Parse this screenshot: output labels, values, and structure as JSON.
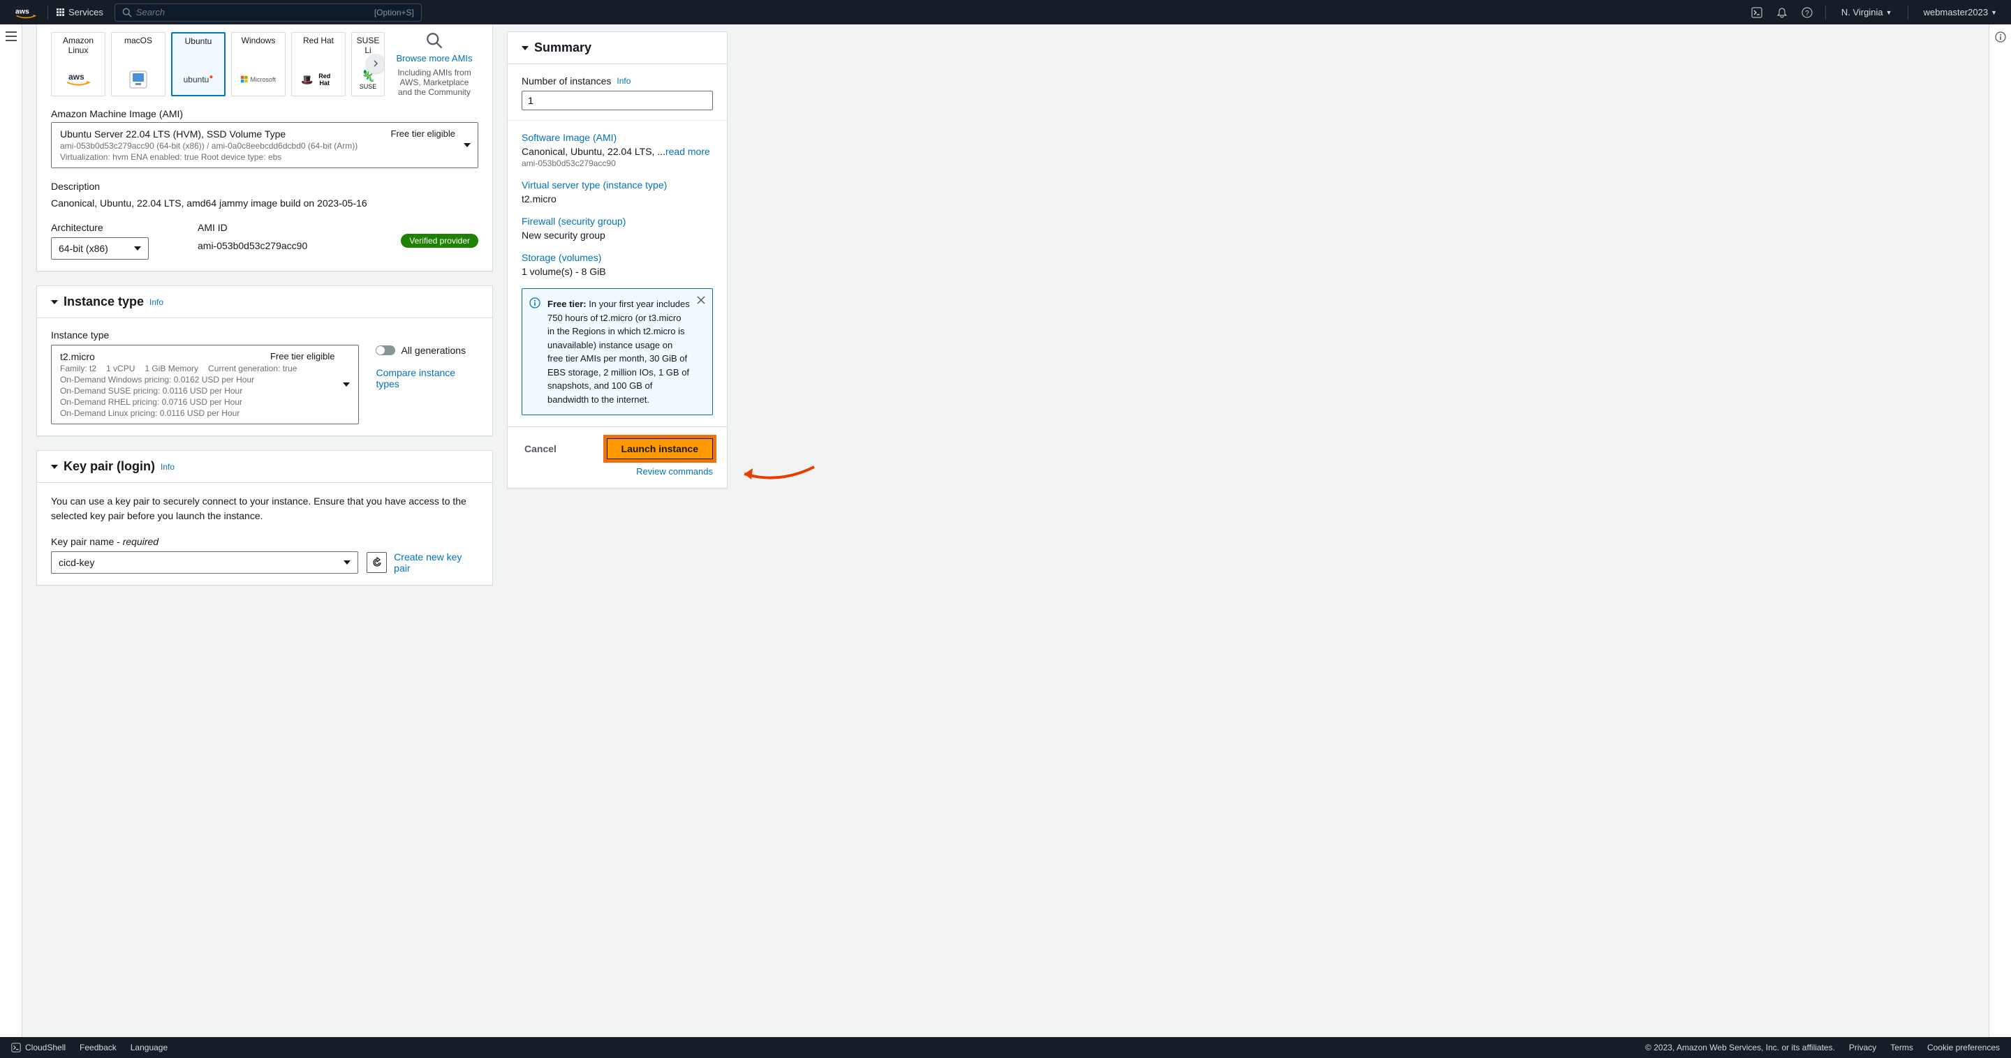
{
  "nav": {
    "services": "Services",
    "search_placeholder": "Search",
    "search_kbd": "[Option+S]",
    "region": "N. Virginia",
    "user": "webmaster2023"
  },
  "os_tiles": [
    {
      "label": "Amazon Linux",
      "logo": "aws"
    },
    {
      "label": "macOS",
      "logo": "mac"
    },
    {
      "label": "Ubuntu",
      "logo": "ubuntu",
      "selected": true
    },
    {
      "label": "Windows",
      "logo": "microsoft"
    },
    {
      "label": "Red Hat",
      "logo": "redhat"
    },
    {
      "label": "SUSE Li",
      "logo": "suse",
      "partial": true
    }
  ],
  "browse": {
    "link": "Browse more AMIs",
    "sub": "Including AMIs from AWS, Marketplace and the Community"
  },
  "ami": {
    "section_label": "Amazon Machine Image (AMI)",
    "title": "Ubuntu Server 22.04 LTS (HVM), SSD Volume Type",
    "free": "Free tier eligible",
    "sub1": "ami-053b0d53c279acc90 (64-bit (x86)) / ami-0a0c8eebcdd6dcbd0 (64-bit (Arm))",
    "sub2": "Virtualization: hvm    ENA enabled: true    Root device type: ebs",
    "desc_label": "Description",
    "desc": "Canonical, Ubuntu, 22.04 LTS, amd64 jammy image build on 2023-05-16",
    "arch_label": "Architecture",
    "arch_value": "64-bit (x86)",
    "amiid_label": "AMI ID",
    "amiid_value": "ami-053b0d53c279acc90",
    "verified": "Verified provider"
  },
  "instance_type": {
    "header": "Instance type",
    "info": "Info",
    "label": "Instance type",
    "name": "t2.micro",
    "free": "Free tier eligible",
    "meta1": [
      "Family: t2",
      "1 vCPU",
      "1 GiB Memory",
      "Current generation: true"
    ],
    "pricing": [
      "On-Demand Windows pricing: 0.0162 USD per Hour",
      "On-Demand SUSE pricing: 0.0116 USD per Hour",
      "On-Demand RHEL pricing: 0.0716 USD per Hour",
      "On-Demand Linux pricing: 0.0116 USD per Hour"
    ],
    "all_gen": "All generations",
    "compare": "Compare instance types"
  },
  "keypair": {
    "header": "Key pair (login)",
    "info": "Info",
    "desc": "You can use a key pair to securely connect to your instance. Ensure that you have access to the selected key pair before you launch the instance.",
    "name_label": "Key pair name - ",
    "required": "required",
    "value": "cicd-key",
    "create": "Create new key pair"
  },
  "summary": {
    "header": "Summary",
    "num_label": "Number of instances",
    "info": "Info",
    "num_value": "1",
    "sw_label": "Software Image (AMI)",
    "sw_val": "Canonical, Ubuntu, 22.04 LTS, ...",
    "readmore": "read more",
    "sw_sub": "ami-053b0d53c279acc90",
    "vs_label": "Virtual server type (instance type)",
    "vs_val": "t2.micro",
    "fw_label": "Firewall (security group)",
    "fw_val": "New security group",
    "st_label": "Storage (volumes)",
    "st_val": "1 volume(s) - 8 GiB",
    "free_tier_bold": "Free tier:",
    "free_tier": " In your first year includes 750 hours of t2.micro (or t3.micro in the Regions in which t2.micro is unavailable) instance usage on free tier AMIs per month, 30 GiB of EBS storage, 2 million IOs, 1 GB of snapshots, and 100 GB of bandwidth to the internet.",
    "cancel": "Cancel",
    "launch": "Launch instance",
    "review": "Review commands"
  },
  "footer": {
    "cloudshell": "CloudShell",
    "feedback": "Feedback",
    "language": "Language",
    "copyright": "© 2023, Amazon Web Services, Inc. or its affiliates.",
    "privacy": "Privacy",
    "terms": "Terms",
    "cookie": "Cookie preferences"
  }
}
